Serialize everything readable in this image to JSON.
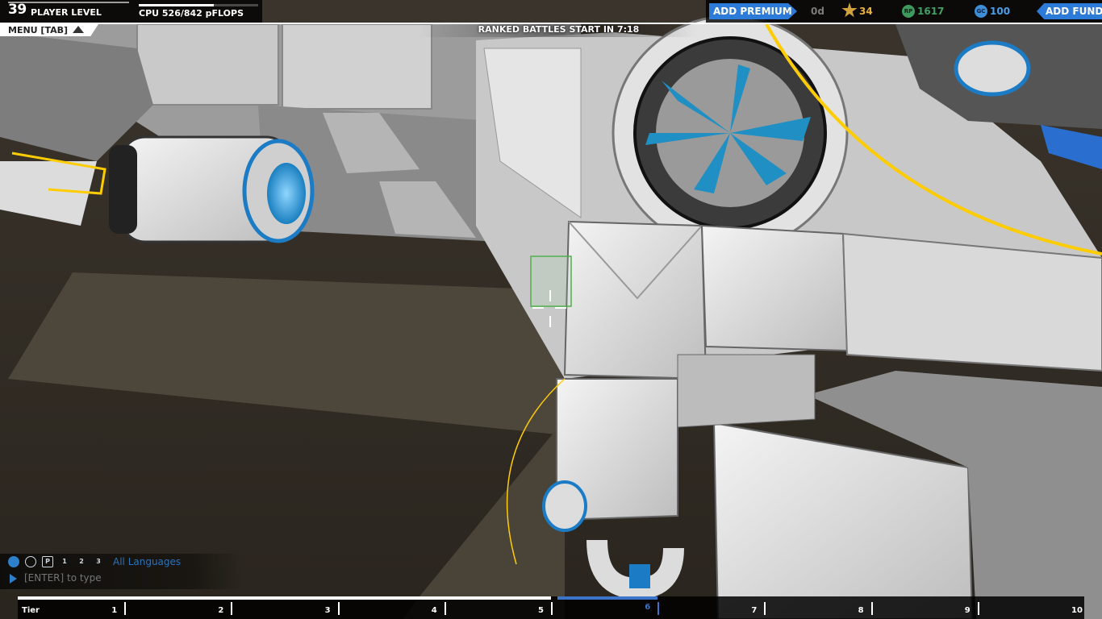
{
  "player": {
    "level": "39",
    "level_label": "PLAYER LEVEL"
  },
  "cpu": {
    "text": "CPU 526/842 pFLOPS",
    "fraction": 0.625
  },
  "menu": {
    "label": "MENU [TAB]"
  },
  "ranked": {
    "text": "RANKED BATTLES START IN 7:18"
  },
  "topbar": {
    "add_premium": "ADD PREMIUM",
    "premium_days": "0d",
    "stars": "34",
    "robits": "1617",
    "cosmetic_credits": "100",
    "add_funds": "ADD FUNDS",
    "icons": {
      "rank": "rank-star-icon",
      "rp": "rp-coin-icon",
      "gc": "gc-coin-icon"
    },
    "rp_icon_text": "RP",
    "gc_icon_text": "GC"
  },
  "chat": {
    "language": "All Languages",
    "placeholder": "[ENTER] to type",
    "icons": [
      "globe-icon",
      "person-icon",
      "party-icon",
      "team1-icon",
      "team2-icon",
      "team3-icon"
    ],
    "party_text": "P",
    "team_texts": [
      "1",
      "2",
      "3"
    ]
  },
  "tiers": {
    "label": "Tier",
    "numbers": [
      "1",
      "2",
      "3",
      "4",
      "5",
      "6",
      "7",
      "8",
      "9",
      "10"
    ],
    "current": "6",
    "progress": 0.5
  },
  "colors": {
    "accent_blue": "#2c7bd8",
    "gold": "#e9b243",
    "green": "#3fa164",
    "gc_blue": "#4a9eeb",
    "yellow_ring": "#ffcc00"
  }
}
